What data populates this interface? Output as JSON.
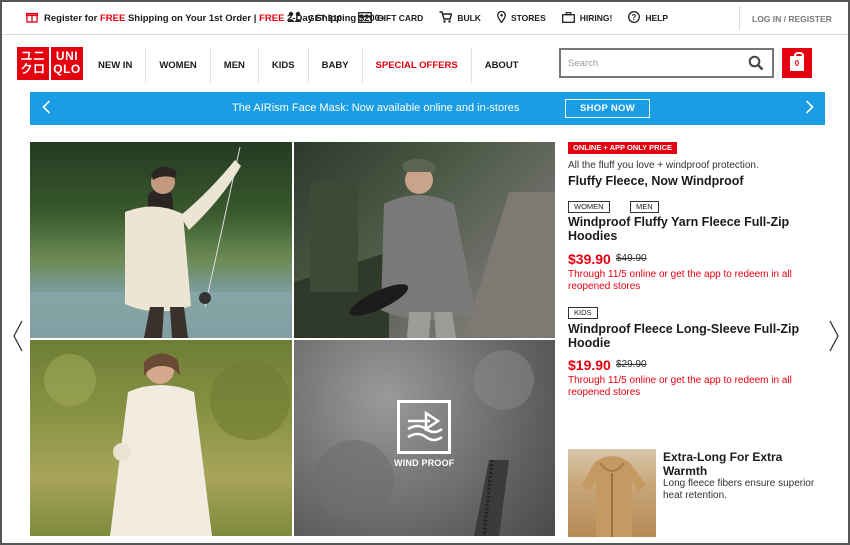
{
  "promo_bar": {
    "register_text": "Register for",
    "free_1": "FREE",
    "shipping_text": "Shipping on Your 1st Order |",
    "free_2": "FREE",
    "two_day_text": "2-Day Shipping $200+",
    "utils": [
      {
        "label": "GET $10",
        "icon": "gift-people-icon"
      },
      {
        "label": "GIFT CARD",
        "icon": "gift-card-icon"
      },
      {
        "label": "BULK",
        "icon": "cart-icon"
      },
      {
        "label": "STORES",
        "icon": "location-pin-icon"
      },
      {
        "label": "HIRING!",
        "icon": "briefcase-icon"
      },
      {
        "label": "HELP",
        "icon": "question-icon"
      }
    ],
    "login": "LOG IN / REGISTER"
  },
  "logo": {
    "left": "ユニ\nクロ",
    "right": "UNI\nQLO"
  },
  "nav": {
    "items": [
      "NEW IN",
      "WOMEN",
      "MEN",
      "KIDS",
      "BABY",
      "SPECIAL OFFERS",
      "ABOUT"
    ]
  },
  "search": {
    "placeholder": "Search"
  },
  "cart": {
    "count": "0"
  },
  "banner": {
    "text": "The AIRism Face Mask: Now available online and in-stores",
    "button": "SHOP NOW"
  },
  "hero": {
    "wind_proof_label": "WIND PROOF"
  },
  "featured": {
    "tag": "ONLINE + APP ONLY PRICE",
    "lead": "All the fluff you love + windproof protection.",
    "title": "Fluffy Fleece, Now Windproof",
    "products": [
      {
        "tags": [
          "WOMEN",
          "MEN"
        ],
        "title": "Windproof Fluffy Yarn Fleece Full-Zip Hoodies",
        "price": "$39.90",
        "was": "$49.90",
        "note": "Through 11/5 online or get the app to redeem in all reopened stores"
      },
      {
        "tags": [
          "KIDS"
        ],
        "title": "Windproof Fleece Long-Sleeve Full-Zip Hoodie",
        "price": "$19.90",
        "was": "$29.90",
        "note": "Through 11/5 online or get the app to redeem in all reopened stores"
      }
    ]
  },
  "promo_card": {
    "title": "Extra-Long For Extra Warmth",
    "desc": "Long fleece fibers ensure superior heat retention."
  },
  "colors": {
    "brand_red": "#e50010",
    "banner_blue": "#1a9de4"
  }
}
